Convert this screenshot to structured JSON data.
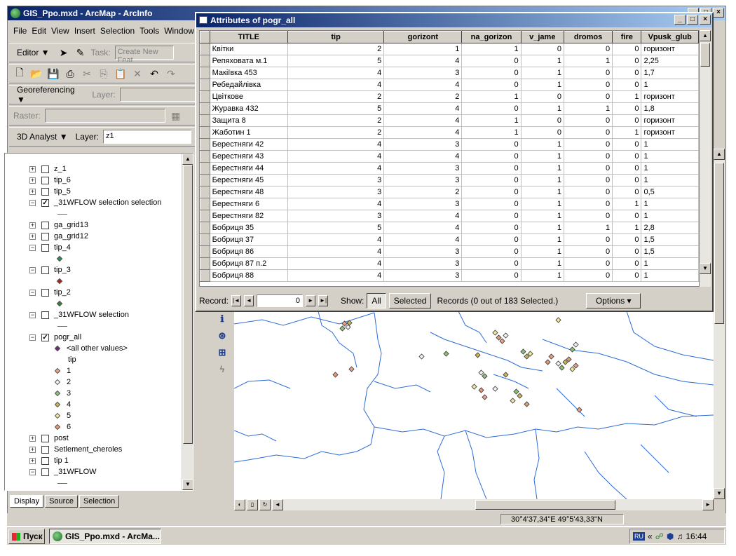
{
  "window": {
    "title": "GIS_Ppo.mxd - ArcMap - ArcInfo",
    "buttons": [
      "_",
      "□",
      "×"
    ]
  },
  "menu": [
    "File",
    "Edit",
    "View",
    "Insert",
    "Selection",
    "Tools",
    "Window"
  ],
  "editor_toolbar": {
    "editor_label": "Editor ▼",
    "task_label": "Task:",
    "task_value": "Create New Feat"
  },
  "georef_toolbar": {
    "label": "Georeferencing ▼",
    "layer_label": "Layer:"
  },
  "raster_toolbar": {
    "label": "Raster:"
  },
  "analyst_toolbar": {
    "label": "3D Analyst ▼",
    "layer_label": "Layer:",
    "layer_value": "z1"
  },
  "toc": {
    "layers": [
      {
        "name": "z_1",
        "checked": false,
        "expand": "+"
      },
      {
        "name": "tip_6",
        "checked": false,
        "expand": "+"
      },
      {
        "name": "tip_5",
        "checked": false,
        "expand": "+"
      },
      {
        "name": "_31WFLOW selection selection",
        "checked": true,
        "expand": "−"
      },
      {
        "name": "ga_grid13",
        "checked": false,
        "expand": "+"
      },
      {
        "name": "ga_grid12",
        "checked": false,
        "expand": "+"
      },
      {
        "name": "tip_4",
        "checked": false,
        "expand": "−"
      },
      {
        "name": "tip_3",
        "checked": false,
        "expand": "−"
      },
      {
        "name": "tip_2",
        "checked": false,
        "expand": "−"
      },
      {
        "name": "_31WFLOW selection",
        "checked": false,
        "expand": "−"
      },
      {
        "name": "pogr_all",
        "checked": true,
        "expand": "−"
      },
      {
        "name": "post",
        "checked": false,
        "expand": "+"
      },
      {
        "name": "Setlement_cheroles",
        "checked": false,
        "expand": "+"
      },
      {
        "name": "tip 1",
        "checked": false,
        "expand": "+"
      },
      {
        "name": "_31WFLOW",
        "checked": false,
        "expand": "−"
      }
    ],
    "legend_other": "<all other values>",
    "legend_field": "tip",
    "legend_values": [
      "1",
      "2",
      "3",
      "4",
      "5",
      "6"
    ]
  },
  "tabs": [
    "Display",
    "Source",
    "Selection"
  ],
  "attributes": {
    "title": "Attributes of pogr_all",
    "columns": [
      "TITLE",
      "tip",
      "gorizont",
      "na_gorizon",
      "v_jame",
      "dromos",
      "fire",
      "Vpusk_glub"
    ],
    "rows": [
      [
        "Квітки",
        "2",
        "1",
        "1",
        "0",
        "0",
        "0",
        "горизонт"
      ],
      [
        "Репяховата м.1",
        "5",
        "4",
        "0",
        "1",
        "1",
        "0",
        "2,25"
      ],
      [
        "Макіївка 453",
        "4",
        "3",
        "0",
        "1",
        "0",
        "0",
        "1,7"
      ],
      [
        "Ребедайлівка",
        "4",
        "4",
        "0",
        "1",
        "0",
        "0",
        "1"
      ],
      [
        "Цвіткове",
        "2",
        "2",
        "1",
        "0",
        "0",
        "1",
        "горизонт"
      ],
      [
        "Журавка 432",
        "5",
        "4",
        "0",
        "1",
        "1",
        "0",
        "1,8"
      ],
      [
        "Защита 8",
        "2",
        "4",
        "1",
        "0",
        "0",
        "0",
        "горизонт"
      ],
      [
        "Жаботин 1",
        "2",
        "4",
        "1",
        "0",
        "0",
        "1",
        "горизонт"
      ],
      [
        "Берестняги 42",
        "4",
        "3",
        "0",
        "1",
        "0",
        "0",
        "1"
      ],
      [
        "Берестняги 43",
        "4",
        "4",
        "0",
        "1",
        "0",
        "0",
        "1"
      ],
      [
        "Берестняги 44",
        "4",
        "3",
        "0",
        "1",
        "0",
        "0",
        "1"
      ],
      [
        "Берестняги 45",
        "3",
        "3",
        "0",
        "1",
        "0",
        "0",
        "1"
      ],
      [
        "Берестняги 48",
        "3",
        "2",
        "0",
        "1",
        "0",
        "0",
        "0,5"
      ],
      [
        "Берестняги 6",
        "4",
        "3",
        "0",
        "1",
        "0",
        "1",
        "1"
      ],
      [
        "Берестняги 82",
        "3",
        "4",
        "0",
        "1",
        "0",
        "0",
        "1"
      ],
      [
        "Бобриця 35",
        "5",
        "4",
        "0",
        "1",
        "1",
        "1",
        "2,8"
      ],
      [
        "Бобриця 37",
        "4",
        "4",
        "0",
        "1",
        "0",
        "0",
        "1,5"
      ],
      [
        "Бобриця 86",
        "4",
        "3",
        "0",
        "1",
        "0",
        "0",
        "1,5"
      ],
      [
        "Бобриця 87 п.2",
        "4",
        "3",
        "0",
        "1",
        "0",
        "0",
        "1"
      ],
      [
        "Бобриця 88",
        "4",
        "3",
        "0",
        "1",
        "0",
        "0",
        "1"
      ]
    ],
    "record_label": "Record:",
    "record_value": "0",
    "show_label": "Show:",
    "all_label": "All",
    "selected_label": "Selected",
    "records_text": "Records  (0 out of 183 Selected.)",
    "options_label": "Options ▾"
  },
  "status": {
    "coords": "30°4'37,34\"E  49°5'43,33\"N"
  },
  "taskbar": {
    "start": "Пуск",
    "item": "GIS_Ppo.mxd - ArcMa...",
    "lang": "RU",
    "time": "16:44"
  }
}
